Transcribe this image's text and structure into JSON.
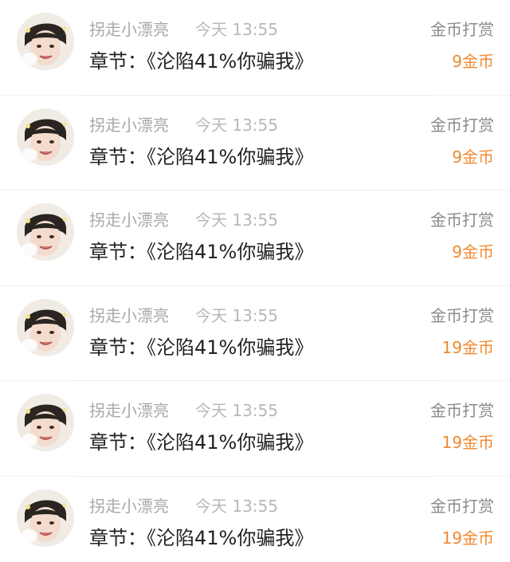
{
  "colors": {
    "accent": "#f08a30",
    "name": "#a8a8a8",
    "time": "#b8b8b8",
    "title": "#222222",
    "kind": "#8a8a8a"
  },
  "list": {
    "items": [
      {
        "user": "拐走小漂亮",
        "time": "今天 13:55",
        "title": "章节：《沦陷41%你骗我》",
        "kind": "金币打赏",
        "amount": "9金币",
        "avatar_icon": "user-avatar"
      },
      {
        "user": "拐走小漂亮",
        "time": "今天 13:55",
        "title": "章节：《沦陷41%你骗我》",
        "kind": "金币打赏",
        "amount": "9金币",
        "avatar_icon": "user-avatar"
      },
      {
        "user": "拐走小漂亮",
        "time": "今天 13:55",
        "title": "章节：《沦陷41%你骗我》",
        "kind": "金币打赏",
        "amount": "9金币",
        "avatar_icon": "user-avatar"
      },
      {
        "user": "拐走小漂亮",
        "time": "今天 13:55",
        "title": "章节：《沦陷41%你骗我》",
        "kind": "金币打赏",
        "amount": "19金币",
        "avatar_icon": "user-avatar"
      },
      {
        "user": "拐走小漂亮",
        "time": "今天 13:55",
        "title": "章节：《沦陷41%你骗我》",
        "kind": "金币打赏",
        "amount": "19金币",
        "avatar_icon": "user-avatar"
      },
      {
        "user": "拐走小漂亮",
        "time": "今天 13:55",
        "title": "章节：《沦陷41%你骗我》",
        "kind": "金币打赏",
        "amount": "19金币",
        "avatar_icon": "user-avatar"
      }
    ]
  }
}
